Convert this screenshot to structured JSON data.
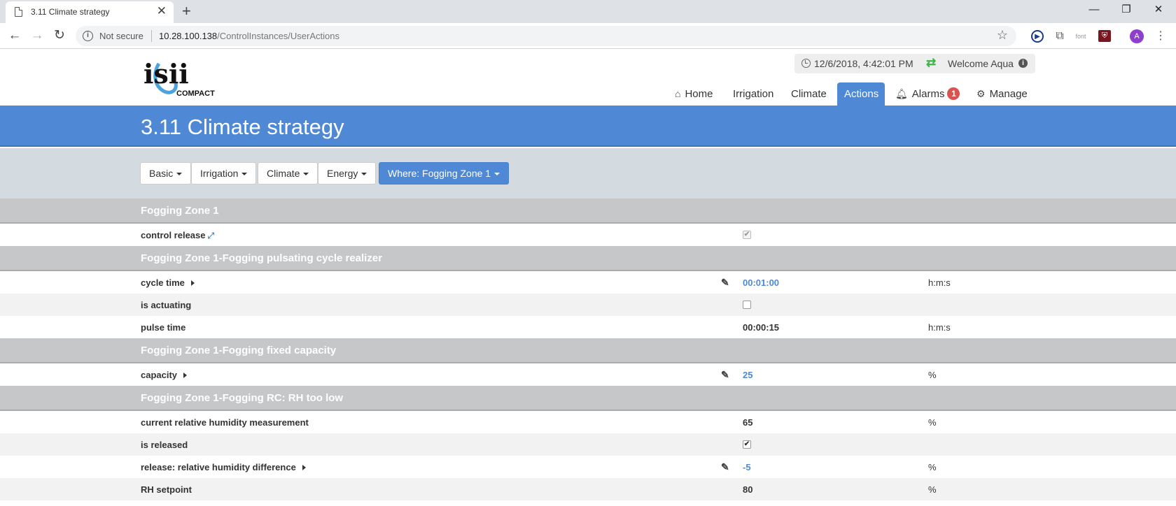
{
  "browser": {
    "tab_title": "3.11 Climate strategy",
    "not_secure": "Not secure",
    "url_host": "10.28.100.138",
    "url_path": "/ControlInstances/UserActions",
    "ext_font_label": "font",
    "avatar_letter": "A"
  },
  "header": {
    "logo_text": "isii",
    "logo_sub": "COMPACT",
    "datetime": "12/6/2018, 4:42:01 PM",
    "welcome": "Welcome Aqua",
    "nav": {
      "home": "Home",
      "irrigation": "Irrigation",
      "climate": "Climate",
      "actions": "Actions",
      "alarms": "Alarms",
      "alarm_count": "1",
      "manage": "Manage"
    }
  },
  "page_title": "3.11 Climate strategy",
  "filters": {
    "basic": "Basic",
    "irrigation": "Irrigation",
    "climate": "Climate",
    "energy": "Energy",
    "where": "Where: Fogging Zone 1"
  },
  "sections": [
    {
      "title": "Fogging Zone 1",
      "rows": [
        {
          "label": "control release",
          "checked": true,
          "disabled": true
        }
      ]
    },
    {
      "title": "Fogging Zone 1-Fogging pulsating cycle realizer",
      "rows": [
        {
          "label": "cycle time",
          "value": "00:01:00",
          "unit": "h:m:s"
        },
        {
          "label": "is actuating",
          "checked": false
        },
        {
          "label": "pulse time",
          "value": "00:00:15",
          "unit": "h:m:s"
        }
      ]
    },
    {
      "title": "Fogging Zone 1-Fogging fixed capacity",
      "rows": [
        {
          "label": "capacity",
          "value": "25",
          "unit": "%"
        }
      ]
    },
    {
      "title": "Fogging Zone 1-Fogging RC: RH too low",
      "rows": [
        {
          "label": "current relative humidity measurement",
          "value": "65",
          "unit": "%"
        },
        {
          "label": "is released",
          "checked": true
        },
        {
          "label": "release: relative humidity difference",
          "value": "-5",
          "unit": "%"
        },
        {
          "label": "RH setpoint",
          "value": "80",
          "unit": "%"
        }
      ]
    }
  ]
}
